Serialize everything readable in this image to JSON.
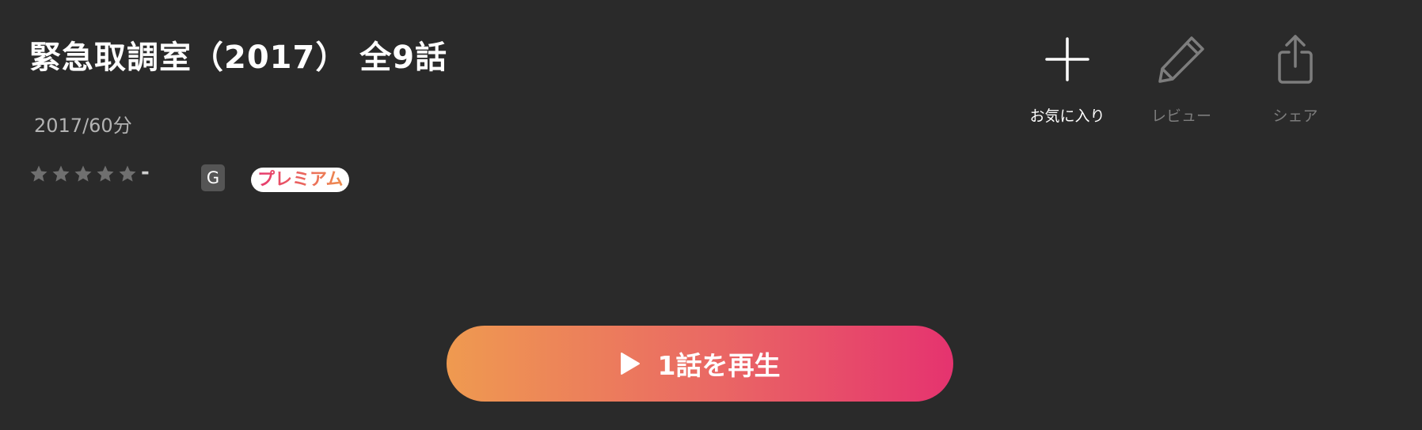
{
  "header": {
    "title": "緊急取調室（2017） 全9話",
    "meta": "2017/60分"
  },
  "rating": {
    "max_stars": 5,
    "value": "-",
    "star_color": "#6f6f6f",
    "star_icon": "star-icon"
  },
  "badges": {
    "age": "G",
    "premium": "プレミアム",
    "premium_gradient": [
      "#e6386f",
      "#ee8d4e"
    ]
  },
  "actions": {
    "favorite": {
      "label": "お気に入り",
      "icon": "plus-icon",
      "color": "#ffffff"
    },
    "review": {
      "label": "レビュー",
      "icon": "pencil-icon",
      "color": "#7d7d7d"
    },
    "share": {
      "label": "シェア",
      "icon": "share-icon",
      "color": "#7d7d7d"
    }
  },
  "play": {
    "label": "1話を再生",
    "icon": "play-icon",
    "gradient": [
      "#ef9a50",
      "#e5336f"
    ]
  },
  "colors": {
    "background": "#2a2a2a",
    "text_primary": "#ffffff",
    "text_secondary": "#b3b3b3"
  }
}
